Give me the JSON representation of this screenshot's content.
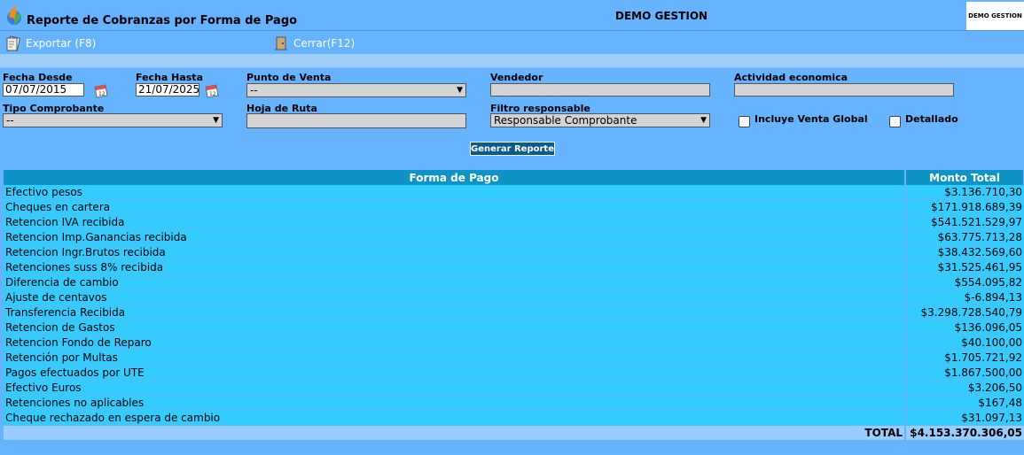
{
  "header": {
    "title": "Reporte de Cobranzas por Forma de Pago",
    "company": "DEMO GESTION",
    "brand": "DEMO GESTION"
  },
  "toolbar": {
    "export_label": "Exportar (F8)",
    "close_label": "Cerrar(F12)"
  },
  "filters": {
    "fecha_desde_label": "Fecha Desde",
    "fecha_desde_value": "07/07/2015",
    "fecha_hasta_label": "Fecha Hasta",
    "fecha_hasta_value": "21/07/2025",
    "punto_venta_label": "Punto de Venta",
    "punto_venta_value": "--",
    "vendedor_label": "Vendedor",
    "vendedor_value": "",
    "actividad_label": "Actividad economica",
    "actividad_value": "",
    "tipo_comprobante_label": "Tipo Comprobante",
    "tipo_comprobante_value": "--",
    "hoja_ruta_label": "Hoja de Ruta",
    "hoja_ruta_value": "",
    "filtro_responsable_label": "Filtro responsable",
    "filtro_responsable_value": "Responsable Comprobante",
    "incluye_venta_global_label": "Incluye Venta Global",
    "detallado_label": "Detallado",
    "generate_label": "Generar Reporte"
  },
  "table": {
    "headers": [
      "Forma de Pago",
      "Monto Total"
    ],
    "rows": [
      {
        "forma": "Efectivo pesos",
        "monto": "$3.136.710,30"
      },
      {
        "forma": "Cheques en cartera",
        "monto": "$171.918.689,39"
      },
      {
        "forma": "Retencion IVA recibida",
        "monto": "$541.521.529,97"
      },
      {
        "forma": "Retencion Imp.Ganancias recibida",
        "monto": "$63.775.713,28"
      },
      {
        "forma": "Retencion Ingr.Brutos recibida",
        "monto": "$38.432.569,60"
      },
      {
        "forma": "Retenciones suss 8% recibida",
        "monto": "$31.525.461,95"
      },
      {
        "forma": "Diferencia de cambio",
        "monto": "$554.095,82"
      },
      {
        "forma": "Ajuste de centavos",
        "monto": "$-6.894,13"
      },
      {
        "forma": "Transferencia Recibida",
        "monto": "$3.298.728.540,79"
      },
      {
        "forma": "Retencion de Gastos",
        "monto": "$136.096,05"
      },
      {
        "forma": "Retencion Fondo de Reparo",
        "monto": "$40.100,00"
      },
      {
        "forma": "Retención por Multas",
        "monto": "$1.705.721,92"
      },
      {
        "forma": "Pagos efectuados por UTE",
        "monto": "$1.867.500,00"
      },
      {
        "forma": "Efectivo Euros",
        "monto": "$3.206,50"
      },
      {
        "forma": "Retenciones no aplicables",
        "monto": "$167,48"
      },
      {
        "forma": "Cheque rechazado en espera de cambio",
        "monto": "$31.097,13"
      }
    ],
    "total_label": "TOTAL",
    "total_value": "$4.153.370.306,05"
  }
}
